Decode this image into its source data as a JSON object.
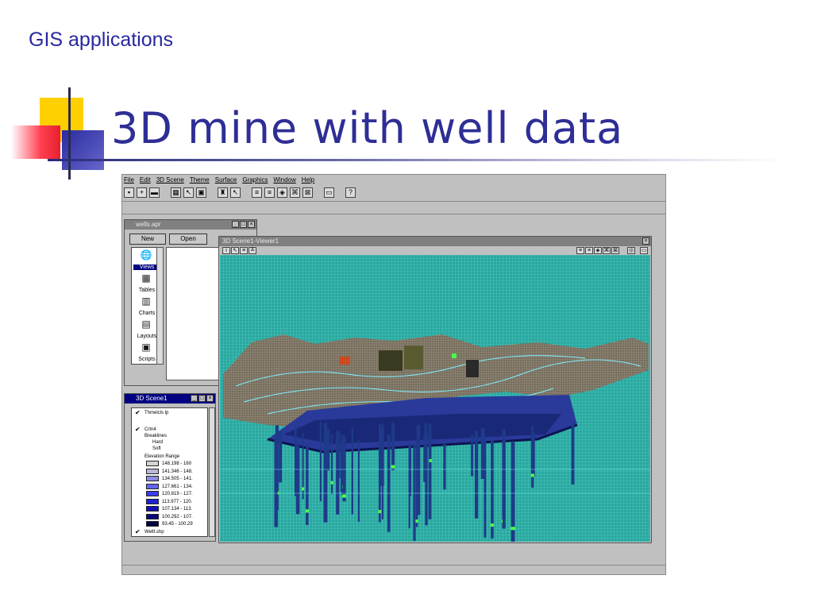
{
  "slide": {
    "section_label": "GIS applications",
    "title": "3D mine with well data"
  },
  "colors": {
    "title": "#2e2e96",
    "terrain_bg": "#2aa8a0",
    "well": "#1e3a88",
    "well_cap": "#4cff4c"
  },
  "app": {
    "menu": [
      "File",
      "Edit",
      "3D Scene",
      "Theme",
      "Surface",
      "Graphics",
      "Window",
      "Help"
    ],
    "project_window": {
      "title": "wells.apr",
      "new_button": "New",
      "open_button": "Open",
      "items": [
        "Views",
        "Tables",
        "Charts",
        "Layouts",
        "Scripts"
      ]
    },
    "scene_window": {
      "title": "3D Scene1-Viewer1"
    },
    "legend_window": {
      "title": "3D Scene1",
      "themes": [
        "Thmelcls lp",
        "Crtn4",
        "Wellt.shp"
      ],
      "breaklines_label": "Breaklines",
      "hard_label": "Hard",
      "soft_label": "Soft",
      "range_label": "Elevation Range",
      "ranges": [
        {
          "label": "148.198 - 160",
          "color": "#d4d4d4"
        },
        {
          "label": "141.346 - 148.",
          "color": "#b8b8d8"
        },
        {
          "label": "134.505 - 141.",
          "color": "#8c8ce8"
        },
        {
          "label": "127.661 - 134.",
          "color": "#6464f0"
        },
        {
          "label": "120.819 - 127.",
          "color": "#3c3cf0"
        },
        {
          "label": "113.977 - 120.",
          "color": "#2020d8"
        },
        {
          "label": "107.134 - 113.",
          "color": "#1010b4"
        },
        {
          "label": "100.292 - 107.",
          "color": "#08087c"
        },
        {
          "label": "93.45 - 100.29",
          "color": "#040440"
        }
      ]
    }
  }
}
